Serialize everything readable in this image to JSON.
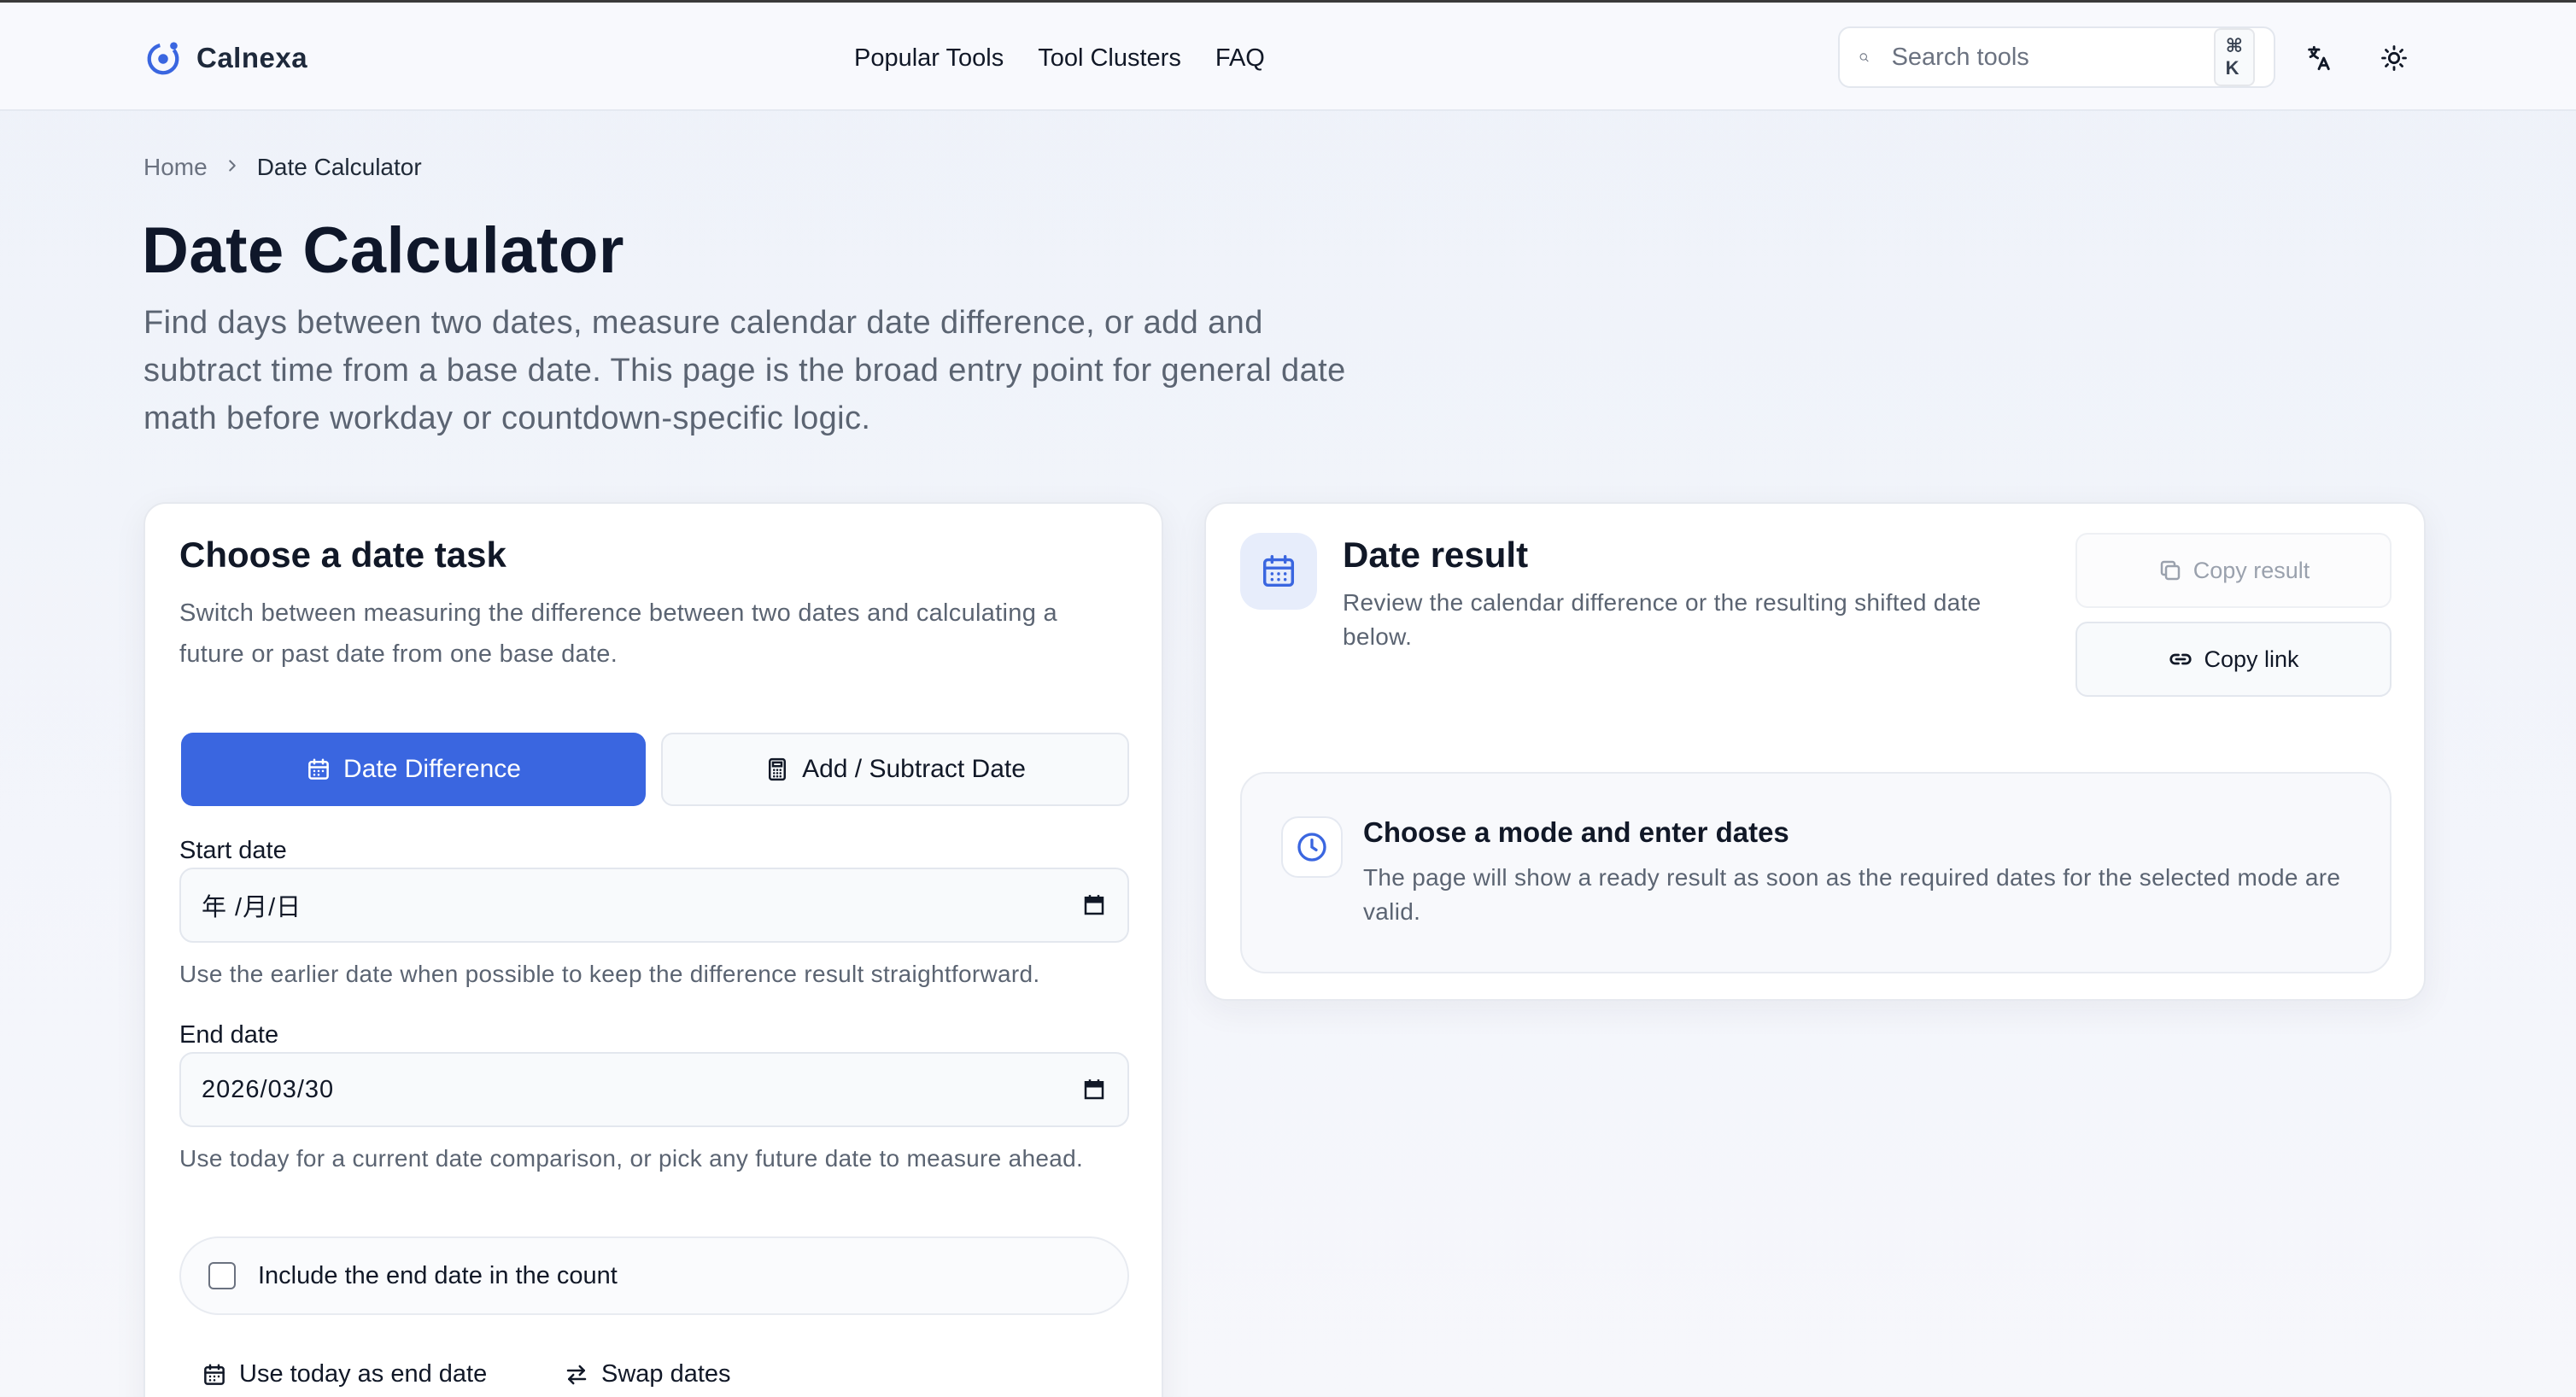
{
  "header": {
    "brand_name": "Calnexa",
    "nav": [
      {
        "label": "Popular Tools"
      },
      {
        "label": "Tool Clusters"
      },
      {
        "label": "FAQ"
      }
    ],
    "search_placeholder": "Search tools",
    "search_shortcut": "⌘ K",
    "language_icon": "translate-icon",
    "theme_icon": "sun-icon"
  },
  "breadcrumb": {
    "home": "Home",
    "current": "Date Calculator"
  },
  "hero": {
    "title": "Date Calculator",
    "description": "Find days between two dates, measure calendar date difference, or add and subtract time from a base date. This page is the broad entry point for general date math before workday or countdown-specific logic."
  },
  "task_card": {
    "title": "Choose a date task",
    "description": "Switch between measuring the difference between two dates and calculating a future or past date from one base date.",
    "modes": [
      {
        "label": "Date Difference",
        "active": true,
        "icon": "calendar-icon"
      },
      {
        "label": "Add / Subtract Date",
        "active": false,
        "icon": "calculator-icon"
      }
    ],
    "start_date": {
      "label": "Start date",
      "value": "年 /月/日",
      "help": "Use the earlier date when possible to keep the difference result straightforward."
    },
    "end_date": {
      "label": "End date",
      "value": "2026/03/30",
      "help": "Use today for a current date comparison, or pick any future date to measure ahead."
    },
    "include_end_date": {
      "label": "Include the end date in the count",
      "checked": false
    },
    "actions": [
      {
        "label": "Use today as end date",
        "icon": "calendar-icon"
      },
      {
        "label": "Swap dates",
        "icon": "swap-icon"
      }
    ]
  },
  "result_card": {
    "title": "Date result",
    "description": "Review the calendar difference or the resulting shifted date below.",
    "copy_result_label": "Copy result",
    "copy_link_label": "Copy link",
    "empty_state": {
      "title": "Choose a mode and enter dates",
      "description": "The page will show a ready result as soon as the required dates for the selected mode are valid."
    }
  },
  "colors": {
    "accent": "#3a66e0",
    "accent_soft": "#e7edfb",
    "text_primary": "#111827",
    "text_muted": "#5b6472"
  }
}
